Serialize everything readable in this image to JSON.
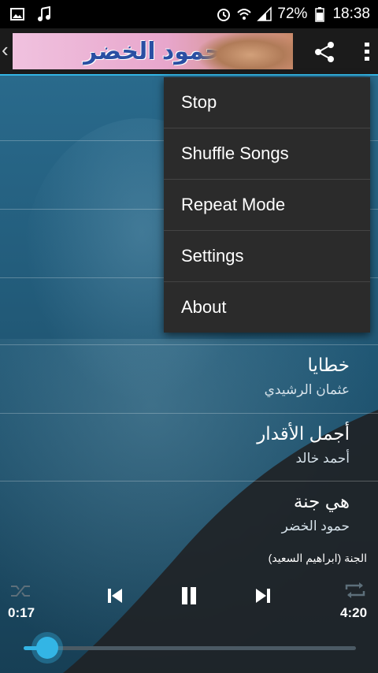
{
  "status_bar": {
    "battery_percent": "72%",
    "time": "18:38"
  },
  "action_bar": {
    "banner_text": "حمود الخضر"
  },
  "menu": {
    "items": [
      "Stop",
      "Shuffle Songs",
      "Repeat Mode",
      "Settings",
      "About"
    ]
  },
  "songs": [
    {
      "title": "خطايا",
      "artist": "عثمان الرشيدي"
    },
    {
      "title": "أجمل الأقدار",
      "artist": "أحمد خالد"
    },
    {
      "title": "هي جنة",
      "artist": "حمود الخضر"
    }
  ],
  "player": {
    "now_playing": "الجنة (ابراهيم السعيد)",
    "elapsed": "0:17",
    "duration": "4:20",
    "progress_fraction": 0.07
  },
  "colors": {
    "accent": "#33b5e5",
    "menu_bg": "#2b2b2b"
  }
}
